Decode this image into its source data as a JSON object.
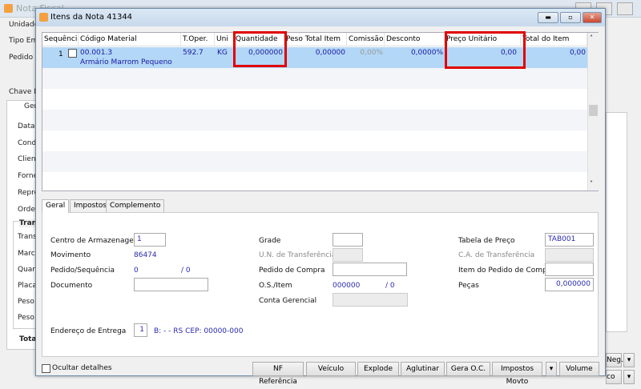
{
  "parent": {
    "title": "Nota Fiscal",
    "labels": [
      "Unidade",
      "Tipo Emi",
      "Pedido",
      "Chave N",
      "Ger",
      "Data",
      "Condi",
      "Client",
      "Forne",
      "Repre",
      "Orden",
      "Tran",
      "Trans",
      "Marca",
      "Quan",
      "Placa",
      "Peso",
      "Peso",
      "Tota"
    ],
    "btn_right1": "Neg.",
    "btn_right2": "co"
  },
  "dialog": {
    "title": "Itens da Nota 41344",
    "min": "▬",
    "max": "▫",
    "close": "✕"
  },
  "grid": {
    "headers": [
      "Sequência",
      "Código Material",
      "T.Oper.",
      "Uni",
      "Quantidade",
      "Peso Total Item",
      "Comissão",
      "Desconto",
      "Preço Unitário",
      "Total do Item"
    ],
    "row": {
      "seq": "1",
      "codigo": "00.001.3",
      "descricao": "Armário Marrom Pequeno",
      "toper": "592.7",
      "uni": "KG",
      "quantidade": "0,000000",
      "peso": "0,00000",
      "comissao": "0,00%",
      "desconto": "0,0000%",
      "preco": "0,00",
      "total": "0,00"
    }
  },
  "tabs": [
    "Geral",
    "Impostos",
    "Complemento"
  ],
  "form": {
    "centro_label": "Centro de Armazenagem",
    "centro": "1",
    "movimento_label": "Movimento",
    "movimento": "86474",
    "pedseq_label": "Pedido/Sequência",
    "pedido": "0",
    "sequencia": "/ 0",
    "documento_label": "Documento",
    "endereco_label": "Endereço de Entrega",
    "endereco_num": "1",
    "endereco": "B:  -  - RS CEP: 00000-000",
    "grade_label": "Grade",
    "un_transf_label": "U.N. de Transferência",
    "pedido_compra_label": "Pedido de Compra",
    "os_label": "O.S./Item",
    "os": "000000",
    "os_item": "/ 0",
    "conta_label": "Conta Gerencial",
    "tabela_label": "Tabela de Preço",
    "tabela": "TAB001",
    "ca_label": "C.A. de Transferência",
    "item_pc_label": "Item do Pedido de Compra",
    "pecas_label": "Peças",
    "pecas": "0,000000"
  },
  "footer": {
    "ocultar": "Ocultar detalhes",
    "buttons": [
      "NF Referência",
      "Veículo",
      "Explode",
      "Aglutinar",
      "Gera O.C.",
      "Impostos Movto",
      "Volume"
    ]
  }
}
